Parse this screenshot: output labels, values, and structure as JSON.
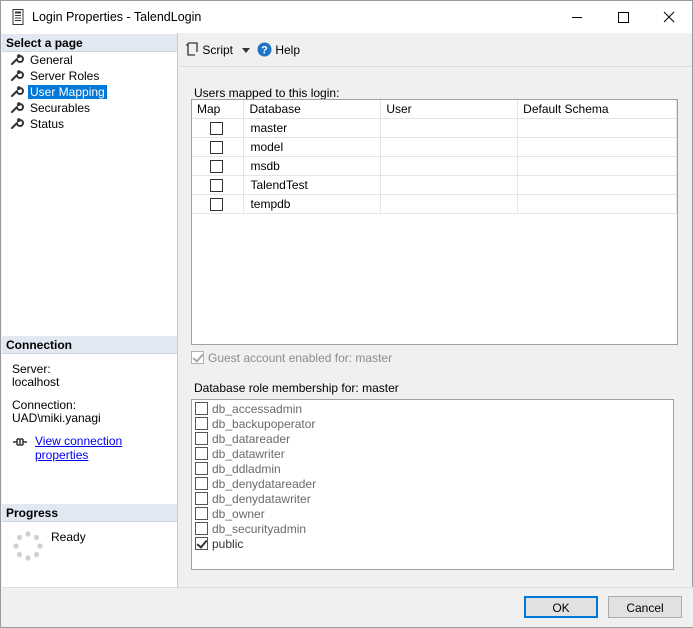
{
  "window": {
    "title": "Login Properties - TalendLogin"
  },
  "left_pane": {
    "select_page_header": "Select a page",
    "pages": [
      {
        "label": "General",
        "selected": false
      },
      {
        "label": "Server Roles",
        "selected": false
      },
      {
        "label": "User Mapping",
        "selected": true
      },
      {
        "label": "Securables",
        "selected": false
      },
      {
        "label": "Status",
        "selected": false
      }
    ],
    "connection_header": "Connection",
    "server_label": "Server:",
    "server_value": "localhost",
    "connection_label": "Connection:",
    "connection_value": "UAD\\miki.yanagi",
    "view_connection_link": "View connection properties",
    "progress_header": "Progress",
    "progress_status": "Ready"
  },
  "toolbar": {
    "script_label": "Script",
    "help_label": "Help"
  },
  "users_mapped": {
    "label": "Users mapped to this login:",
    "columns": [
      "Map",
      "Database",
      "User",
      "Default Schema"
    ],
    "rows": [
      {
        "map": false,
        "database": "master",
        "user": "",
        "schema": ""
      },
      {
        "map": false,
        "database": "model",
        "user": "",
        "schema": ""
      },
      {
        "map": false,
        "database": "msdb",
        "user": "",
        "schema": ""
      },
      {
        "map": false,
        "database": "TalendTest",
        "user": "",
        "schema": ""
      },
      {
        "map": false,
        "database": "tempdb",
        "user": "",
        "schema": ""
      }
    ]
  },
  "guest": {
    "label": "Guest account enabled for: master",
    "checked": true,
    "enabled": false
  },
  "role_membership": {
    "label": "Database role membership for: master",
    "roles": [
      {
        "name": "db_accessadmin",
        "checked": false
      },
      {
        "name": "db_backupoperator",
        "checked": false
      },
      {
        "name": "db_datareader",
        "checked": false
      },
      {
        "name": "db_datawriter",
        "checked": false
      },
      {
        "name": "db_ddladmin",
        "checked": false
      },
      {
        "name": "db_denydatareader",
        "checked": false
      },
      {
        "name": "db_denydatawriter",
        "checked": false
      },
      {
        "name": "db_owner",
        "checked": false
      },
      {
        "name": "db_securityadmin",
        "checked": false
      },
      {
        "name": "public",
        "checked": true
      }
    ]
  },
  "buttons": {
    "ok": "OK",
    "cancel": "Cancel"
  }
}
